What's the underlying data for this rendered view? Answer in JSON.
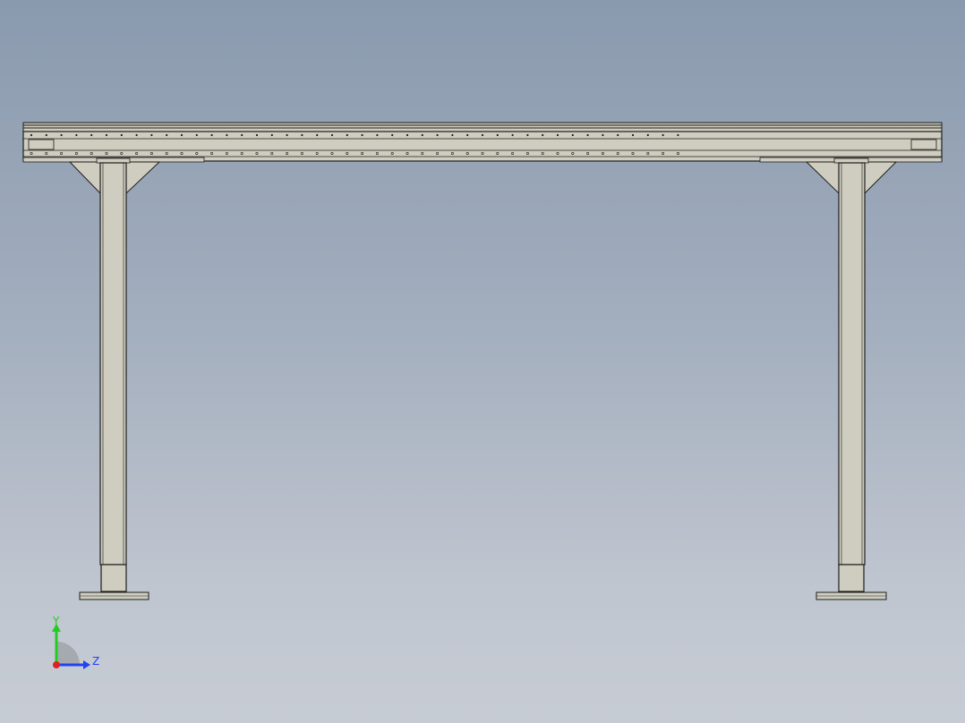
{
  "viewport": {
    "background_top": "#8a9aae",
    "background_bottom": "#c7ccd4"
  },
  "model": {
    "description_name": "conveyor-frame-front-view",
    "part_fill": "#cfcdbf",
    "part_fill_dark": "#bdbbae",
    "edge_color": "#1e1e1e"
  },
  "triad": {
    "y_label": "Y",
    "z_label": "Z",
    "y_color": "#22cc22",
    "z_color": "#2244ee",
    "x_color": "#e02020",
    "arc_color": "#a0a4aa"
  }
}
